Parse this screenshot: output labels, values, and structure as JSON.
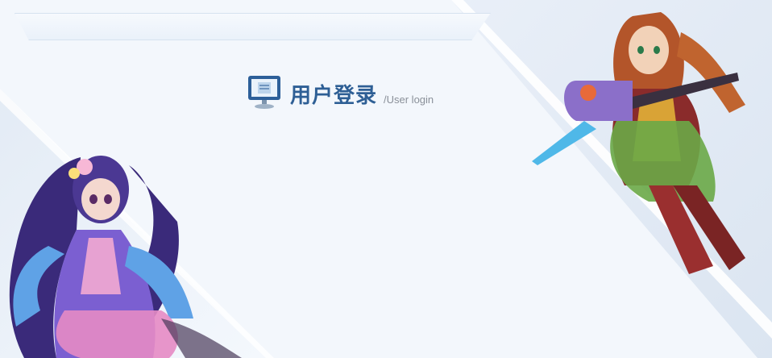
{
  "login": {
    "title": "用户登录",
    "subtitle": "/User login",
    "icon": "monitor-icon"
  },
  "decor": {
    "left_character": "girl-character-illustration",
    "right_character": "warrior-character-illustration"
  },
  "colors": {
    "background": "#f3f7fc",
    "title": "#2e5f95",
    "subtitle": "#8a9099"
  }
}
